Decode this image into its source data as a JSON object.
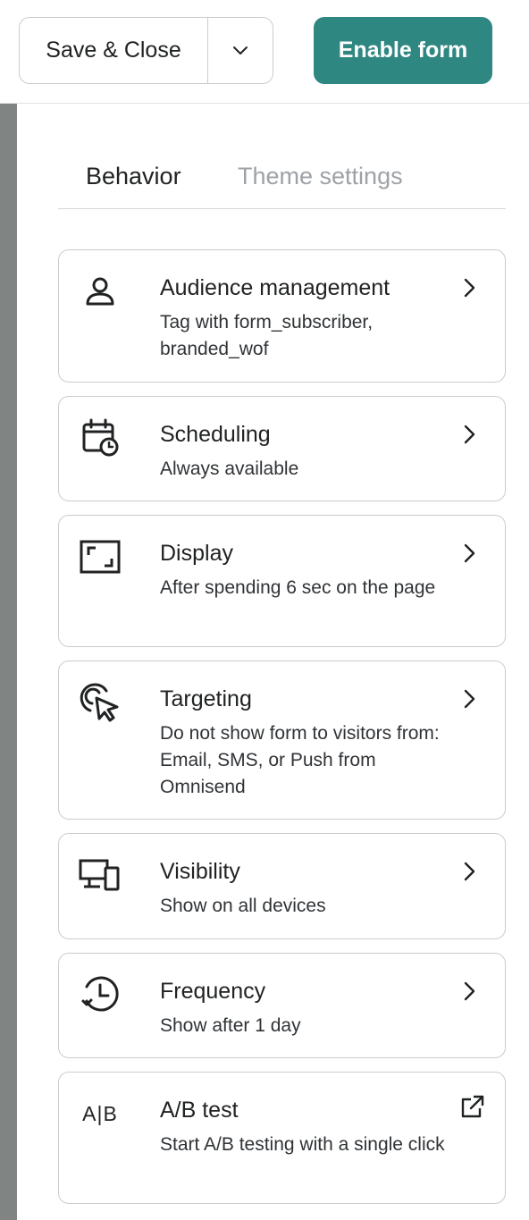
{
  "toolbar": {
    "save_close_label": "Save & Close",
    "enable_form_label": "Enable form",
    "enable_color": "#2f8782"
  },
  "tabs": [
    {
      "label": "Behavior",
      "active": true
    },
    {
      "label": "Theme settings",
      "active": false
    }
  ],
  "cards": [
    {
      "icon": "person-icon",
      "title": "Audience management",
      "desc": "Tag with form_subscriber, branded_wof",
      "action": "chevron-right-icon"
    },
    {
      "icon": "calendar-clock-icon",
      "title": "Scheduling",
      "desc": "Always available",
      "action": "chevron-right-icon"
    },
    {
      "icon": "display-frame-icon",
      "title": "Display",
      "desc": "After spending 6 sec on the page",
      "action": "chevron-right-icon"
    },
    {
      "icon": "target-cursor-icon",
      "title": "Targeting",
      "desc": "Do not show form to visitors from: Email, SMS, or Push from Omnisend",
      "action": "chevron-right-icon"
    },
    {
      "icon": "devices-icon",
      "title": "Visibility",
      "desc": "Show on all devices",
      "action": "chevron-right-icon"
    },
    {
      "icon": "history-clock-icon",
      "title": "Frequency",
      "desc": "Show after 1 day",
      "action": "chevron-right-icon"
    },
    {
      "icon": "ab-icon",
      "icon_text": "A|B",
      "title": "A/B test",
      "desc": "Start A/B testing with a single click",
      "action": "external-link-icon"
    }
  ]
}
